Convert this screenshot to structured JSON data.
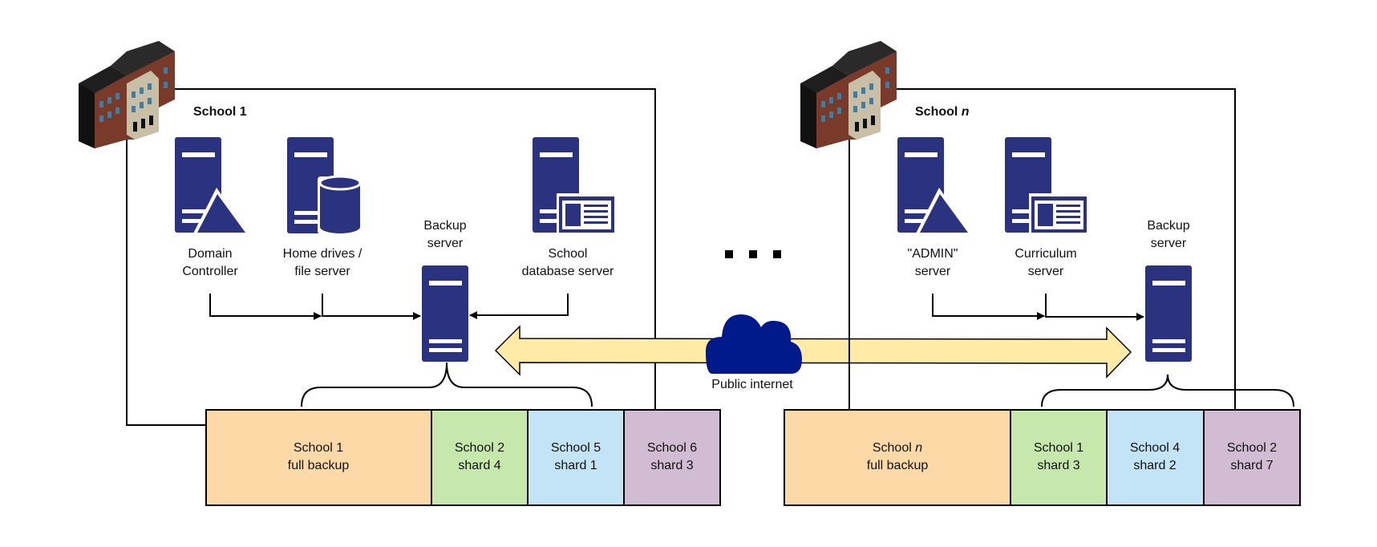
{
  "colors": {
    "server": "#2b3380",
    "cloud": "#001a8c",
    "arrow": "#ffeaa6",
    "full_backup": "#fdd9a8",
    "shard_green": "#c7e8ad",
    "shard_blue": "#c2e4f6",
    "shard_purple": "#d2bcd3"
  },
  "school1": {
    "title": "School 1",
    "servers": [
      {
        "line1": "Domain",
        "line2": "Controller",
        "icon": "domain-controller-server-icon"
      },
      {
        "line1": "Home drives /",
        "line2": "file server",
        "icon": "file-server-icon"
      },
      {
        "line1": "School",
        "line2": "database server",
        "icon": "database-server-icon"
      }
    ],
    "backup": {
      "line1": "Backup",
      "line2": "server"
    },
    "storage": [
      {
        "line1": "School 1",
        "line2": "full backup"
      },
      {
        "line1": "School 2",
        "line2": "shard 4"
      },
      {
        "line1": "School 5",
        "line2": "shard 1"
      },
      {
        "line1": "School 6",
        "line2": "shard 3"
      }
    ]
  },
  "schooln": {
    "title_prefix": "School ",
    "title_var": "n",
    "servers": [
      {
        "line1": "\"ADMIN\"",
        "line2": "server",
        "icon": "admin-server-icon"
      },
      {
        "line1": "Curriculum",
        "line2": "server",
        "icon": "curriculum-server-icon"
      }
    ],
    "backup": {
      "line1": "Backup",
      "line2": "server"
    },
    "storage": [
      {
        "line1_prefix": "School ",
        "line1_var": "n",
        "line2": "full backup"
      },
      {
        "line1": "School 1",
        "line2": "shard 3"
      },
      {
        "line1": "School 4",
        "line2": "shard 2"
      },
      {
        "line1": "School 2",
        "line2": "shard 7"
      }
    ]
  },
  "internet": {
    "label": "Public internet"
  }
}
